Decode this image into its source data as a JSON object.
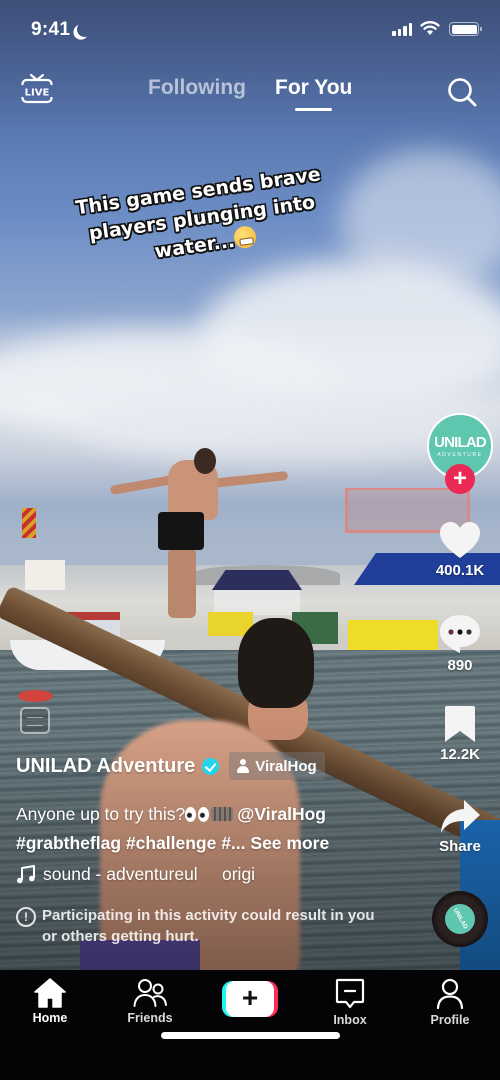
{
  "status_bar": {
    "time": "9:41",
    "focus_icon": "moon-icon",
    "signal_icon": "cellular-signal-icon",
    "wifi_icon": "wifi-icon",
    "battery_icon": "battery-icon"
  },
  "top_nav": {
    "live_icon": "live-tv-icon",
    "live_label": "LIVE",
    "tabs": [
      {
        "label": "Following",
        "active": false
      },
      {
        "label": "For You",
        "active": true
      }
    ],
    "search_icon": "search-icon"
  },
  "video": {
    "caption_lines": [
      "This game sends brave",
      "players plunging into",
      "water..."
    ],
    "caption_emoji": "grimacing-face-emoji"
  },
  "creator": {
    "avatar_title": "UNILAD",
    "avatar_subtitle": "ADVENTURE",
    "name": "UNILAD Adventure",
    "verified": true,
    "tagged_user": "ViralHog"
  },
  "actions": {
    "likes": "400.1K",
    "comments": "890",
    "saves": "12.2K",
    "share_label": "Share"
  },
  "description": {
    "text": "Anyone up to try this?",
    "mention": "@ViralHog",
    "hashtags": "#grabtheflag #challenge #...",
    "see_more": "See more"
  },
  "sound": {
    "text": "sound - adventureul     origi"
  },
  "warning": {
    "text": "Participating in this activity could result in you or others getting hurt."
  },
  "music_disc": {
    "label": "UNILAD"
  },
  "tab_bar": {
    "items": [
      {
        "label": "Home",
        "icon": "home-icon",
        "active": true
      },
      {
        "label": "Friends",
        "icon": "friends-icon",
        "active": false
      },
      {
        "label": "",
        "icon": "create-plus-icon",
        "active": false
      },
      {
        "label": "Inbox",
        "icon": "inbox-icon",
        "active": false
      },
      {
        "label": "Profile",
        "icon": "profile-icon",
        "active": false
      }
    ],
    "create_symbol": "+"
  },
  "colors": {
    "brand_pink": "#fe2c55",
    "brand_cyan": "#25f4ee",
    "follow_red": "#ea2a55",
    "verified_cyan": "#20d5ec",
    "avatar_teal": "#5fc6b0"
  }
}
